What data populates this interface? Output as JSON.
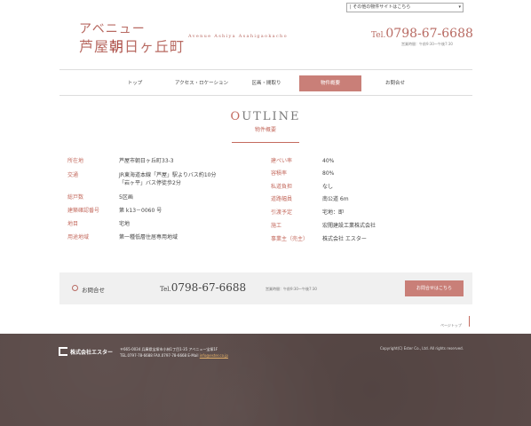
{
  "top_select": {
    "label": "| その他の物件サイトはこちら",
    "arrow": "▾"
  },
  "logo": {
    "line1": "アベニュー",
    "line2_a": "芦屋",
    "line2_b": "朝",
    "line2_c": "日ヶ丘町",
    "en": "Avenue Ashiya Asahigaokacho"
  },
  "header": {
    "tel_prefix": "Tel.",
    "tel": "0798-67-6688",
    "hours": "営業時間：午前9:30～午後7:30"
  },
  "nav": {
    "items": [
      "トップ",
      "アクセス・ロケーション",
      "区画・間取り",
      "物件概要",
      "お問合せ"
    ],
    "active_index": 3
  },
  "outline": {
    "title_first": "O",
    "title_rest": "UTLINE",
    "subtitle": "物件概要"
  },
  "left_rows": [
    {
      "label": "所在地",
      "value": "芦屋市朝日ヶ丘町33-3"
    },
    {
      "label": "交通",
      "value": "JR東海道本線「芦屋」駅よりバス約10分"
    },
    {
      "label": "",
      "value": "「岩ヶ平」バス停徒歩2分"
    },
    {
      "label": "総戸数",
      "value": "5区画"
    },
    {
      "label": "建築確認番号",
      "value": "第 k13－0060 号"
    },
    {
      "label": "地目",
      "value": "宅地"
    },
    {
      "label": "用途地域",
      "value": "第一種低層住居専用地域"
    }
  ],
  "right_rows": [
    {
      "label": "建ぺい率",
      "value": "40%"
    },
    {
      "label": "容積率",
      "value": "80%"
    },
    {
      "label": "私道負担",
      "value": "なし"
    },
    {
      "label": "道路幅員",
      "value": "南公道 6m"
    },
    {
      "label": "引渡予定",
      "value": "宅地：即"
    },
    {
      "label": "施工",
      "value": "宏閲建設工業株式会社"
    },
    {
      "label": "事業主（売主）",
      "value": "株式会社 エスター"
    }
  ],
  "inquiry": {
    "label": "お問合せ",
    "tel_prefix": "Tel.",
    "tel": "0798-67-6688",
    "hours": "営業時間：午前9:30～午後7:30",
    "button": "お問合せはこちら"
  },
  "pagetop": "ページトップ",
  "footer": {
    "company": "株式会社エスター",
    "address": "〒665-0034 兵庫県宝塚市小林1丁目1-35 アベニュー宝塚1F",
    "tel_fax": "TEL.0797-78-6688 FAX.0797-78-6668",
    "mail_label": "E-Mail",
    "mail": "info@ester.co.jp",
    "copyright": "Copyright(C) Ester Co., Ltd. All rights reserved."
  }
}
